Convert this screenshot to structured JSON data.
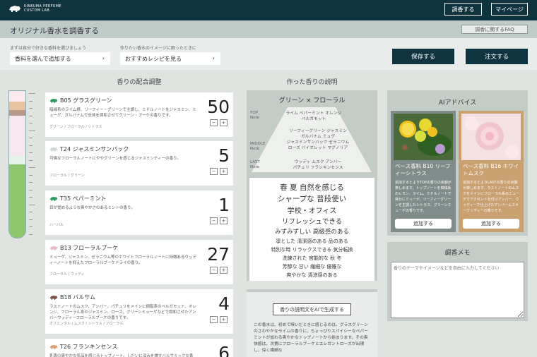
{
  "header": {
    "logo_line1": "KINKUMA PERFUME",
    "logo_line2": "CUSTOM LAB.",
    "btn_compose": "調香する",
    "btn_mypage": "マイページ"
  },
  "subheader": {
    "title": "オリジナル香水を調香する",
    "faq": "調香に関するFAQ"
  },
  "controls": {
    "hint_left": "まずは自分で好きな香料を選びましょう",
    "select_add": "香料を選んで追加する",
    "hint_right": "作りたい香水のイメージに困ったときに",
    "select_recipe": "おすすめレシピを見る",
    "save": "保存する",
    "order": "注文する"
  },
  "columns": {
    "mix_title": "香りの配合調整",
    "desc_title": "作った香りの説明"
  },
  "ingredients": [
    {
      "name": "B05 グラスグリーン",
      "qty": "50",
      "icon_color": "#2a9a5a",
      "desc": "暗緑系のライム様、リーフィー・グリーンで主調し、ミドルノートをジャスミン、ミューゲ、ガルバナムで全体を調和させてグリーン・ブーケの香りです。",
      "tags": "グリーン / フローラル / シトラス"
    },
    {
      "name": "T24 ジャスミンサンバック",
      "qty": "5",
      "icon_color": "#cfd7d3",
      "desc": "可憐なフローラルノートにややグリーンを感じるジャスミンティーの香り。",
      "tags": "フローラル / グリーン"
    },
    {
      "name": "T35 ペパーミント",
      "qty": "1",
      "icon_color": "#2a9a5a",
      "desc": "目が覚めるような爽やかさのあるミントの香り。",
      "tags": "ハーバル"
    },
    {
      "name": "B13 フローラルブーケ",
      "qty": "27",
      "icon_color": "#e8b8c8",
      "desc": "ミューゲ、ジャスミン、ゼラニウム等のホワイトフローラルノートに特徴あるウッディーノートを抑えたフローラルブーケドライの香り。",
      "tags": "フローラル / ウッディ"
    },
    {
      "name": "B18 バルサム",
      "qty": "4",
      "icon_color": "#7a5040",
      "desc": "ラストノートのムスク、アンバー、パチュリをメインに樹脂系のベルガモット、オレンジ、フローラル系のジャスミン、ローズ、グリーンミューゲなどで調和させたアンバーウッディーフローラルブーケの香りです。",
      "tags": "オリエンタル / ムスク / シトラス / フローラル"
    },
    {
      "name": "T26 フランキンセンス",
      "qty": "6",
      "icon_color": "#d8a070",
      "desc": "乳香の爽やかな気品を感じるトップノート。しだいに深みを増すバルサミックな香り。",
      "tags": ""
    }
  ],
  "profile": {
    "title": "グリーン × フローラル",
    "top_label": "TOP\nNote",
    "top_notes": [
      "ライム ペパーミント オレンジ",
      "ベルガモット"
    ],
    "middle_label": "MIDDLE\nNote",
    "middle_notes": [
      "リーフィーグリーン ジャスミン",
      "ガルバナム ミュゲ",
      "ジャスミンサンバック ゼラニウム",
      "ローズ バイオレット マグノリア"
    ],
    "last_label": "LAST\nNote",
    "last_notes": [
      "ウッディ ムスク アンバー",
      "パチュリ フランキンセンス"
    ]
  },
  "impressions": [
    "春 夏 自然を感じる",
    "シャープな 普段使い",
    "学校・オフィス",
    "リフレッシュできる",
    "みずみずしい 高級感のある",
    "凛とした 清潔感のある 品のある",
    "特別な時 リラックスできる 気分転換",
    "洗練された 官能的な 秋 冬",
    "芳醇な 甘い 繊細な 優雅な",
    "爽やかな 清涼感のある"
  ],
  "generate": {
    "button": "香りの説明文をAIで生成する",
    "text": "この香水は、初めて嗅いだときに感じるのは、グラスグリーンのさわやかなライムの香りに、ちょっぴりスパイシーなペパーミントが加わる爽やかなトップノートから始まります。その爽快感は、次第にフローラルブーケとエレガントローズが出現し、深く繊細な"
  },
  "ai": {
    "title": "AIアドバイス",
    "cards": [
      {
        "name": "ベース香料 B10 リーフィーシトラス",
        "desc": "追加するとよりTOPの香りの余韻が楽しめます。トップノートを柑橘系のレモン、ライム、ミドルノートで爽かにミューゲ、リーフィーグリーンを主調したシトラス、グリーンミューゲの香りです。",
        "button": "追加する",
        "color": "#808c8a"
      },
      {
        "name": "ベース香料 B16 ホワイトムスク",
        "desc": "追加するとよりLASTの香りの余韻が楽しめます。ラストノートのムスクをメインにフローラル系のミューゲでアクセントを付けアンバー、ウッディーで仕上げたアンバームスキーウッディーの香りです。",
        "button": "追加する",
        "color": "#c9a070"
      }
    ]
  },
  "memo": {
    "title": "調香メモ",
    "placeholder": "香りのテーマやイメージなどを自由に入力してください"
  }
}
